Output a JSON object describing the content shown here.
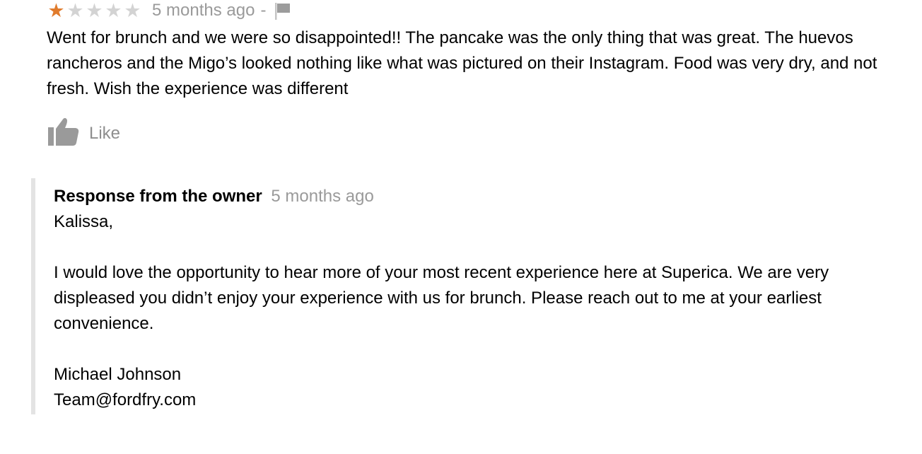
{
  "review": {
    "rating": 1,
    "max_rating": 5,
    "rating_color": "#e07b2c",
    "time_ago": "5 months ago",
    "separator": "-",
    "flag_icon": "flag-icon",
    "text": "Went for brunch and we were so disappointed!! The pancake was the only thing that was great. The huevos rancheros and the Migo’s looked nothing like what was pictured on their Instagram. Food was very dry, and not fresh. Wish the experience was different",
    "like_icon": "thumbs-up-icon",
    "like_label": "Like"
  },
  "owner_response": {
    "title": "Response from the owner",
    "time_ago": "5 months ago",
    "greeting": "Kalissa,",
    "body": "I would love the opportunity to hear more of your most recent experience here at Superica. We are very displeased you didn’t enjoy your experience with us for brunch. Please reach out to me at your earliest convenience.",
    "signature_name": "Michael Johnson",
    "signature_email": "Team@fordfry.com"
  }
}
